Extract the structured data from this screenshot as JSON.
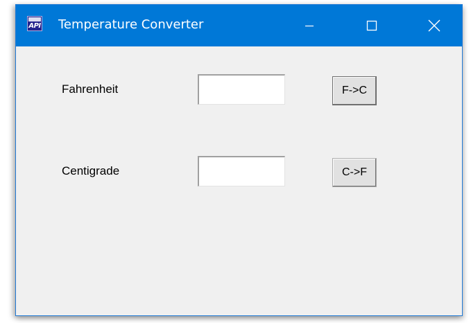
{
  "window": {
    "title": "Temperature Converter",
    "icon": "app-icon",
    "icon_text": "API",
    "controls": {
      "minimize_icon": "minimize-icon",
      "maximize_icon": "maximize-icon",
      "close_icon": "close-icon"
    },
    "colors": {
      "titlebar": "#0078d7",
      "client": "#f0f0f0"
    }
  },
  "form": {
    "fahrenheit": {
      "label": "Fahrenheit",
      "value": "",
      "button_label": "F->C"
    },
    "centigrade": {
      "label": "Centigrade",
      "value": "",
      "button_label": "C->F"
    }
  }
}
